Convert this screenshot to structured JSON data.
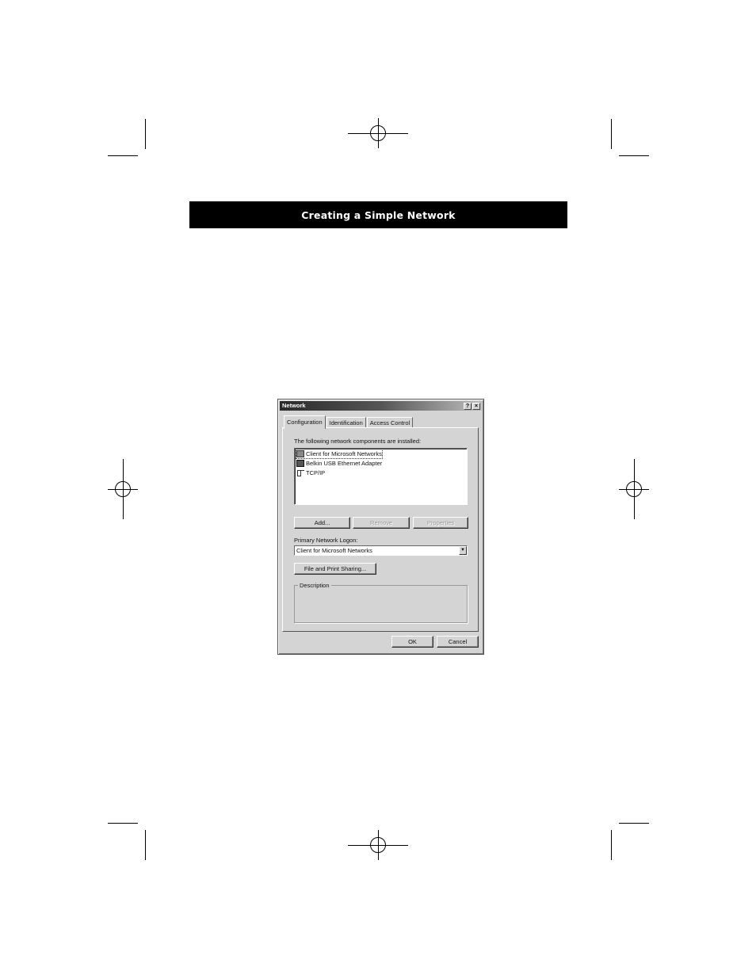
{
  "header": {
    "title": "Creating a Simple Network"
  },
  "dialog": {
    "title": "Network",
    "help_label": "?",
    "close_label": "×",
    "tabs": [
      {
        "label": "Configuration"
      },
      {
        "label": "Identification"
      },
      {
        "label": "Access Control"
      }
    ],
    "components_label": "The following network components are installed:",
    "components": [
      {
        "label": "Client for Microsoft Networks",
        "icon": "client-icon"
      },
      {
        "label": "Belkin USB Ethernet Adapter",
        "icon": "network-adapter-icon"
      },
      {
        "label": "TCP/IP",
        "icon": "protocol-icon"
      }
    ],
    "buttons": {
      "add": "Add...",
      "remove": "Remove",
      "properties": "Properties"
    },
    "primary_logon_label": "Primary Network Logon:",
    "primary_logon_value": "Client for Microsoft Networks",
    "file_print_sharing": "File and Print Sharing...",
    "description_label": "Description",
    "ok": "OK",
    "cancel": "Cancel"
  }
}
